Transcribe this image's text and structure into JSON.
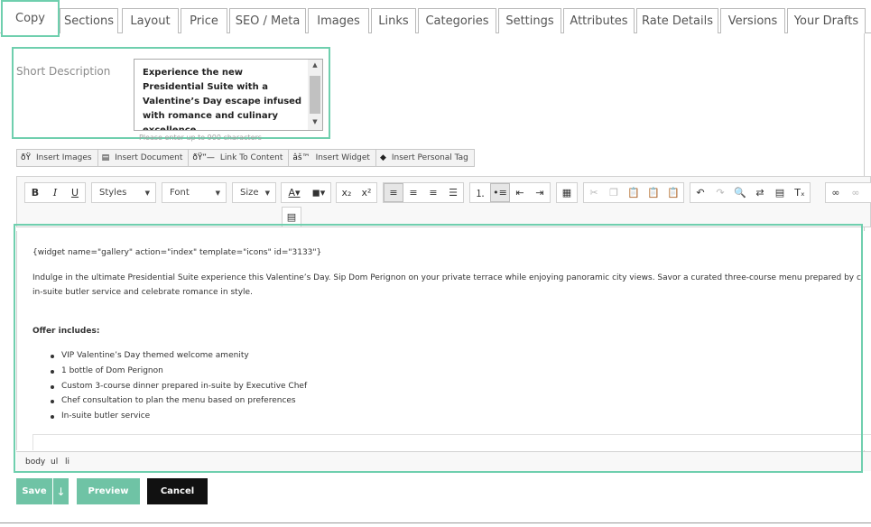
{
  "tabs": [
    {
      "label": "Copy",
      "active": true
    },
    {
      "label": "Sections"
    },
    {
      "label": "Layout"
    },
    {
      "label": "Price"
    },
    {
      "label": "SEO / Meta"
    },
    {
      "label": "Images"
    },
    {
      "label": "Links"
    },
    {
      "label": "Categories"
    },
    {
      "label": "Settings"
    },
    {
      "label": "Attributes"
    },
    {
      "label": "Rate Details"
    },
    {
      "label": "Versions"
    },
    {
      "label": "Your Drafts"
    }
  ],
  "short_description": {
    "label": "Short Description",
    "value": "Experience the new Presidential Suite with a Valentine’s Day escape infused with romance and culinary excellence.",
    "hint": "Please enter up to 900 characters"
  },
  "insert_bar": [
    {
      "icon": "image-icon",
      "glyph": "ðŸ",
      "label": "Insert Images"
    },
    {
      "icon": "document-icon",
      "glyph": "▤",
      "label": "Insert Document"
    },
    {
      "icon": "link-icon",
      "glyph": "ðŸ”—",
      "label": "Link To Content"
    },
    {
      "icon": "widget-icon",
      "glyph": "âš™",
      "label": "Insert Widget"
    },
    {
      "icon": "tag-icon",
      "glyph": "◆",
      "label": "Insert Personal Tag"
    }
  ],
  "toolbar": {
    "styles_label": "Styles",
    "font_label": "Font",
    "size_label": "Size"
  },
  "editor": {
    "widget_line": "{widget name=\"gallery\" action=\"index\" template=\"icons\" id=\"3133\"}",
    "paragraph_line1": "Indulge in the ultimate Presidential Suite experience this Valentine’s Day. Sip Dom Perignon on your private terrace while enjoying panoramic city views. Savor a curated three-course menu prepared by c",
    "paragraph_line2": "in-suite butler service and celebrate romance in style.",
    "offer_heading": "Offer includes:",
    "offer_items": [
      "VIP Valentine’s Day themed welcome amenity",
      "1 bottle of Dom Perignon",
      "Custom 3-course dinner prepared in-suite by Executive Chef",
      "Chef consultation to plan the menu based on preferences",
      "In-suite butler service"
    ],
    "path": [
      "body",
      "ul",
      "li"
    ]
  },
  "actions": {
    "save_label": "Save",
    "save_dropdown_glyph": "↓",
    "preview_label": "Preview",
    "cancel_label": "Cancel"
  },
  "colors": {
    "accent": "#6fcfae",
    "button_green": "#6fc3a5",
    "cancel_black": "#111111"
  }
}
